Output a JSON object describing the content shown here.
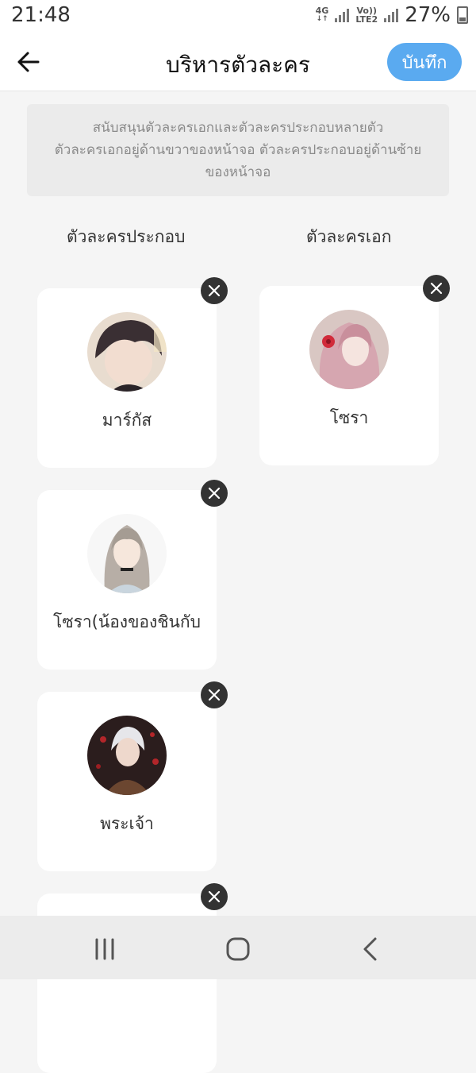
{
  "status_bar": {
    "time": "21:48",
    "network_1": "4G",
    "network_2_top": "Vo))",
    "network_2_bottom": "LTE2",
    "battery": "27%"
  },
  "header": {
    "back_icon": "arrow-left-icon",
    "title": "บริหารตัวละคร",
    "save_label": "บันทึก",
    "accent_color": "#5aaaf0"
  },
  "info": {
    "line1": "สนับสนุนตัวละครเอกและตัวละครประกอบหลายตัว",
    "line2": "ตัวละครเอกอยู่ด้านขวาของหน้าจอ ตัวละครประกอบอยู่ด้านซ้าย",
    "line3": "ของหน้าจอ"
  },
  "columns": {
    "supporting_label": "ตัวละครประกอบ",
    "main_label": "ตัวละครเอก"
  },
  "supporting_characters": [
    {
      "name": "มาร์กัส",
      "avatar": "dark-haired-boy-avatar"
    },
    {
      "name": "โซรา(น้องของชินกับ",
      "avatar": "silver-haired-girl-avatar"
    },
    {
      "name": "พระเจ้า",
      "avatar": "white-haired-boy-avatar"
    }
  ],
  "main_characters": [
    {
      "name": "โซรา",
      "avatar": "pink-haired-girl-avatar"
    }
  ],
  "nav": {
    "recent_icon": "recent-apps-icon",
    "home_icon": "home-icon",
    "back_icon": "back-chevron-icon"
  }
}
